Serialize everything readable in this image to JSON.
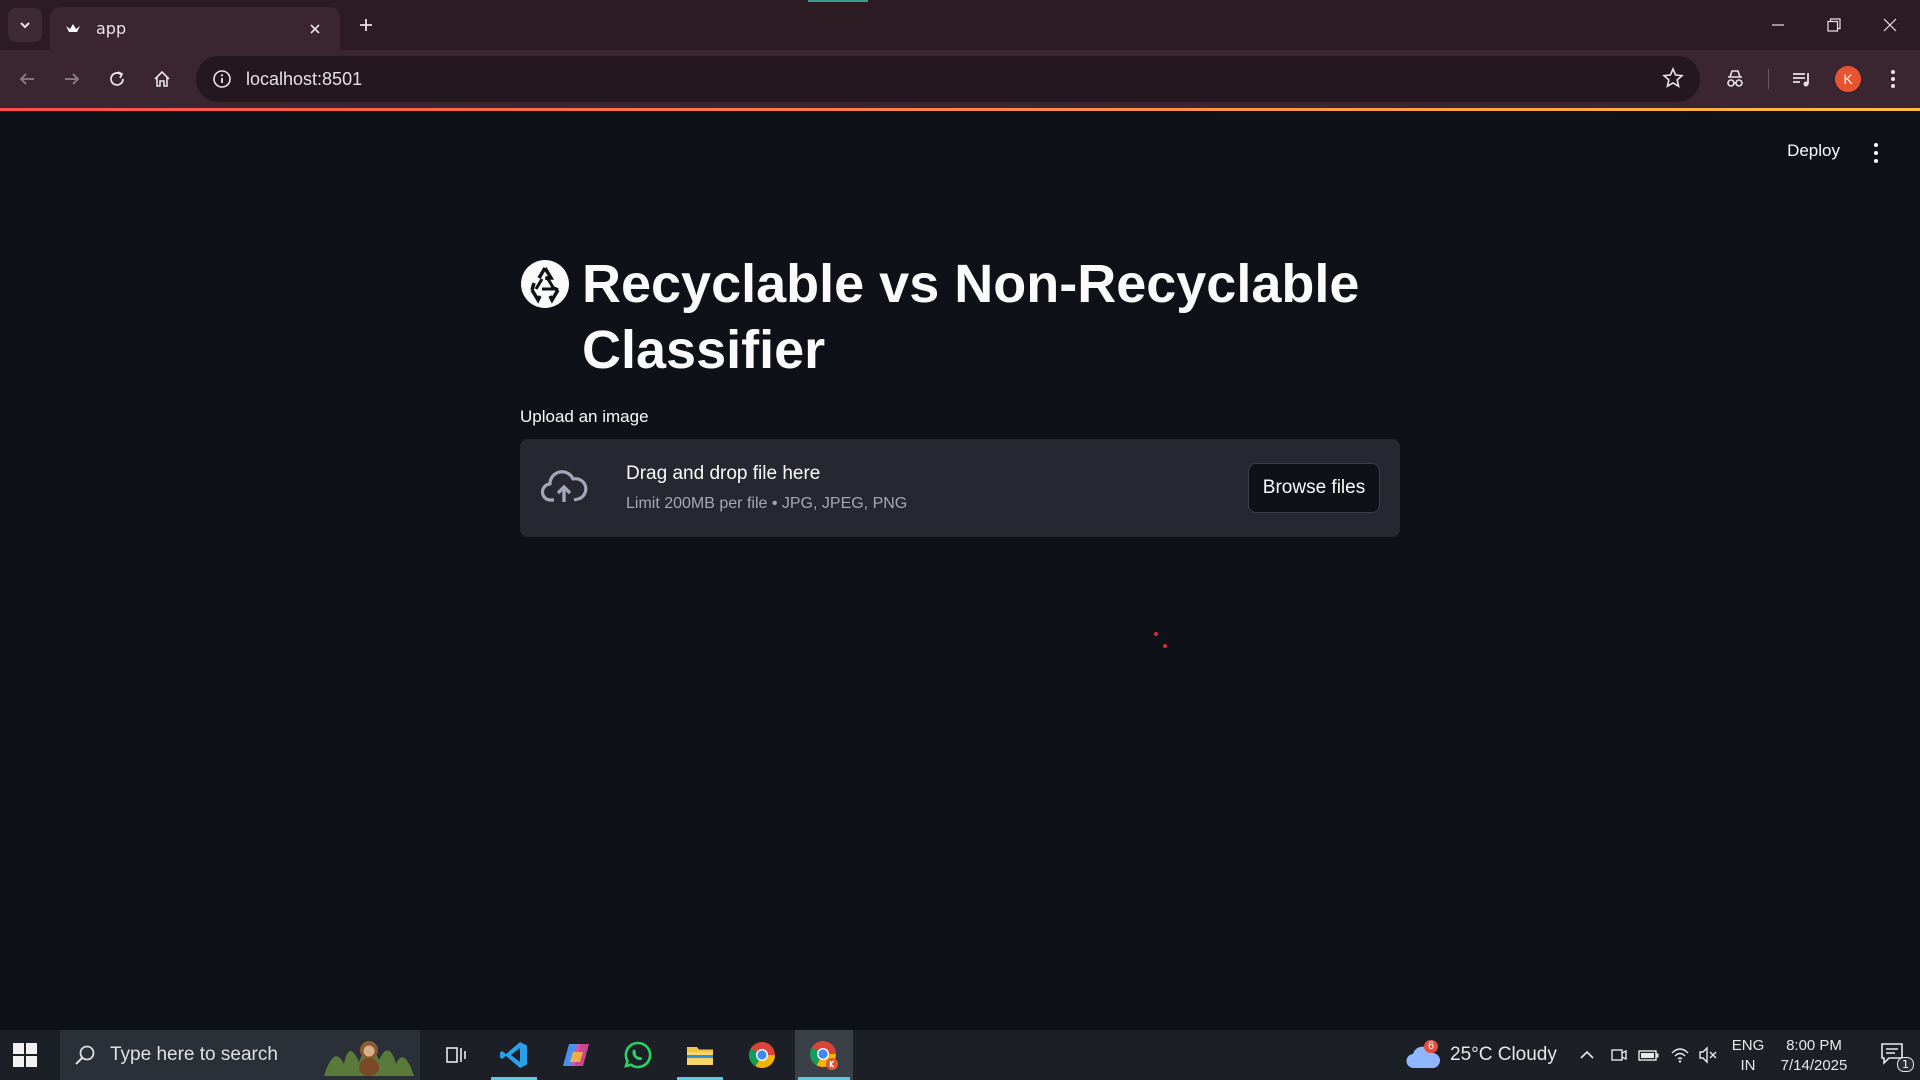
{
  "browser": {
    "tab_title": "app",
    "url": "localhost:8501",
    "profile_initial": "K"
  },
  "app": {
    "deploy_label": "Deploy",
    "title": "Recyclable vs Non-Recyclable Classifier",
    "upload_label": "Upload an image",
    "dropzone_title": "Drag and drop file here",
    "dropzone_limit": "Limit 200MB per file • JPG, JPEG, PNG",
    "browse_label": "Browse files"
  },
  "taskbar": {
    "search_placeholder": "Type here to search",
    "weather_badge": "6",
    "weather": "25°C  Cloudy",
    "lang_line1": "ENG",
    "lang_line2": "IN",
    "time": "8:00 PM",
    "date": "7/14/2025",
    "notification_count": "1"
  },
  "colors": {
    "app_background": "#0e1117",
    "accent": "#ff4b4b",
    "dropzone": "#262730",
    "browser_frame": "#3a2530"
  }
}
